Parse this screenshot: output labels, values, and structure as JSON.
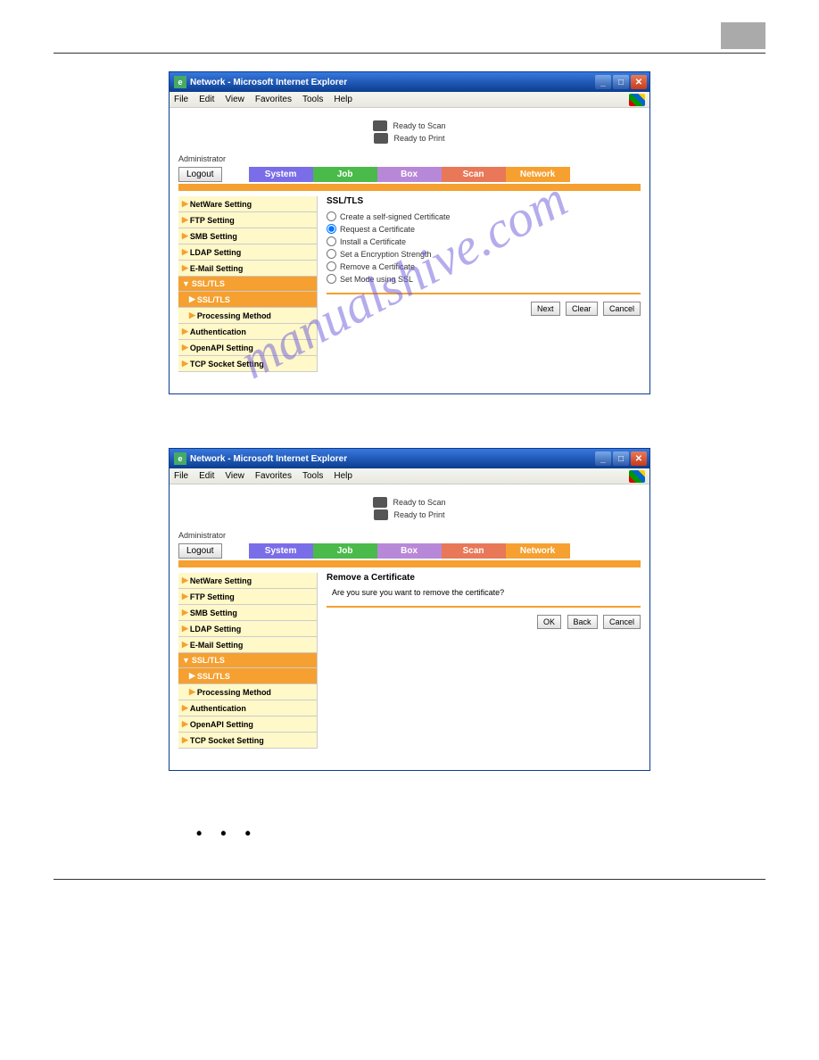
{
  "window": {
    "title": "Network - Microsoft Internet Explorer",
    "menus": [
      "File",
      "Edit",
      "View",
      "Favorites",
      "Tools",
      "Help"
    ]
  },
  "status": {
    "scan": "Ready to Scan",
    "print": "Ready to Print"
  },
  "admin_label": "Administrator",
  "logout": "Logout",
  "tabs": {
    "system": "System",
    "job": "Job",
    "box": "Box",
    "scan": "Scan",
    "network": "Network"
  },
  "sidebar": {
    "netware": "NetWare Setting",
    "ftp": "FTP Setting",
    "smb": "SMB Setting",
    "ldap": "LDAP Setting",
    "email": "E-Mail Setting",
    "ssl_parent": "SSL/TLS",
    "ssl_child": "SSL/TLS",
    "processing": "Processing Method",
    "auth": "Authentication",
    "openapi": "OpenAPI Setting",
    "tcp": "TCP Socket Setting"
  },
  "panel1": {
    "title": "SSL/TLS",
    "options": {
      "create": "Create a self-signed Certificate",
      "request": "Request a Certificate",
      "install": "Install a Certificate",
      "encryption": "Set a Encryption Strength",
      "remove": "Remove a Certificate",
      "mode": "Set Mode using SSL"
    },
    "buttons": {
      "next": "Next",
      "clear": "Clear",
      "cancel": "Cancel"
    }
  },
  "panel2": {
    "title": "Remove a Certificate",
    "confirm": "Are you sure you want to remove the certificate?",
    "buttons": {
      "ok": "OK",
      "back": "Back",
      "cancel": "Cancel"
    }
  },
  "watermark": "manualshive.com",
  "dots": "• • •"
}
